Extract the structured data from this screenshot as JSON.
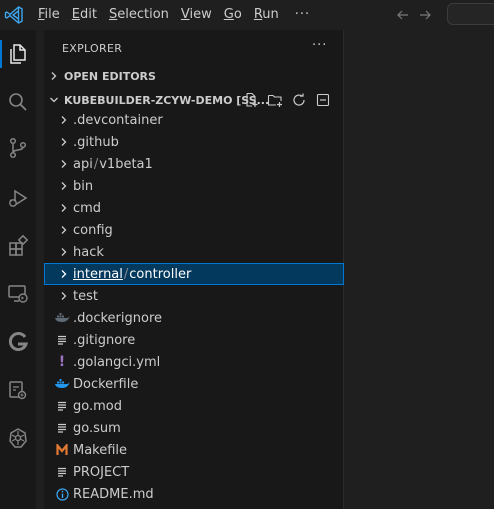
{
  "menu": {
    "items": [
      {
        "first": "F",
        "rest": "ile"
      },
      {
        "first": "E",
        "rest": "dit"
      },
      {
        "first": "S",
        "rest": "election"
      },
      {
        "first": "V",
        "rest": "iew"
      },
      {
        "first": "G",
        "rest": "o"
      },
      {
        "first": "R",
        "rest": "un"
      }
    ],
    "more": "···"
  },
  "sidebar": {
    "title": "EXPLORER",
    "more": "···",
    "open_editors": "OPEN EDITORS",
    "workspace": "KUBEBUILDER-ZCYW-DEMO [SS..."
  },
  "tree": [
    {
      "label": ".devcontainer",
      "kind": "folder"
    },
    {
      "label": ".github",
      "kind": "folder"
    },
    {
      "label_a": "api",
      "label_b": "v1beta1",
      "kind": "folder-compact"
    },
    {
      "label": "bin",
      "kind": "folder"
    },
    {
      "label": "cmd",
      "kind": "folder"
    },
    {
      "label": "config",
      "kind": "folder"
    },
    {
      "label": "hack",
      "kind": "folder"
    },
    {
      "label_a": "internal",
      "label_b": "controller",
      "kind": "folder-compact-selected"
    },
    {
      "label": "test",
      "kind": "folder"
    },
    {
      "label": ".dockerignore",
      "kind": "docker"
    },
    {
      "label": ".gitignore",
      "kind": "lines"
    },
    {
      "label": ".golangci.yml",
      "kind": "yaml"
    },
    {
      "label": "Dockerfile",
      "kind": "docker"
    },
    {
      "label": "go.mod",
      "kind": "lines"
    },
    {
      "label": "go.sum",
      "kind": "lines"
    },
    {
      "label": "Makefile",
      "kind": "makefile"
    },
    {
      "label": "PROJECT",
      "kind": "lines"
    },
    {
      "label": "README.md",
      "kind": "info"
    }
  ],
  "colors": {
    "accent": "#0078d4",
    "selected_bg": "#04395e",
    "docker": "#2496ed",
    "makefile": "#e37933",
    "yaml": "#a074c4"
  }
}
